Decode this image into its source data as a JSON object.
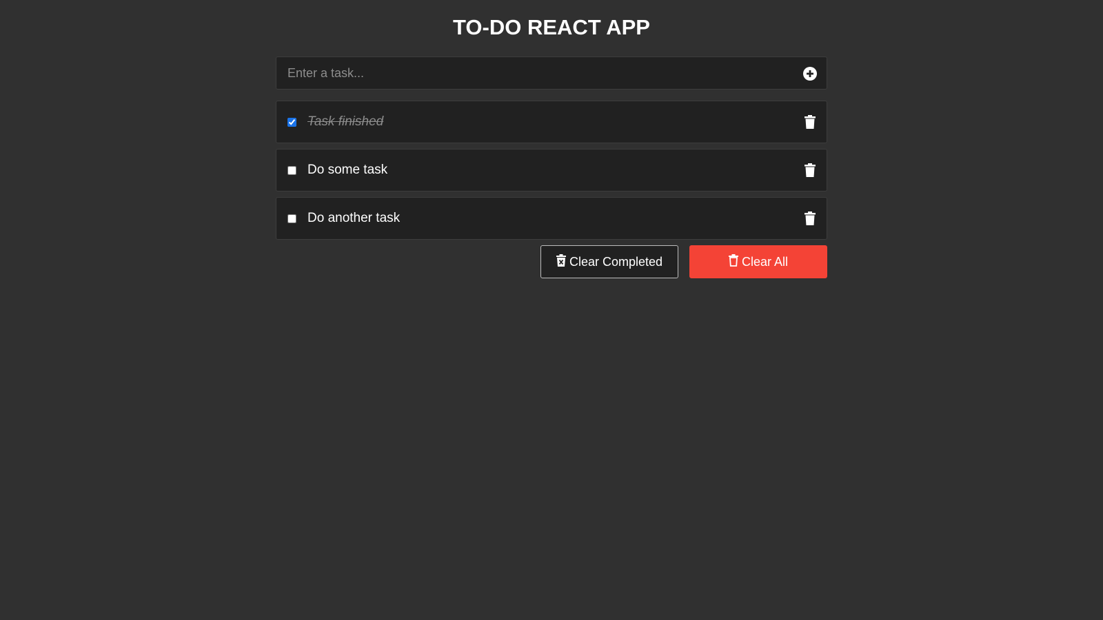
{
  "app": {
    "title": "TO-DO REACT APP"
  },
  "input": {
    "placeholder": "Enter a task...",
    "value": "",
    "add_icon": "plus-circle-icon"
  },
  "tasks": [
    {
      "label": "Task finished",
      "completed": true,
      "delete_icon": "trash-icon"
    },
    {
      "label": "Do some task",
      "completed": false,
      "delete_icon": "trash-icon"
    },
    {
      "label": "Do another task",
      "completed": false,
      "delete_icon": "trash-icon"
    }
  ],
  "actions": {
    "clear_completed_label": "Clear Completed",
    "clear_completed_icon": "trash-x-icon",
    "clear_all_label": "Clear All",
    "clear_all_icon": "trash-outline-icon"
  },
  "colors": {
    "background": "#303030",
    "panel": "#212121",
    "danger": "#f44336",
    "checkbox_accent": "#1a73e8"
  }
}
